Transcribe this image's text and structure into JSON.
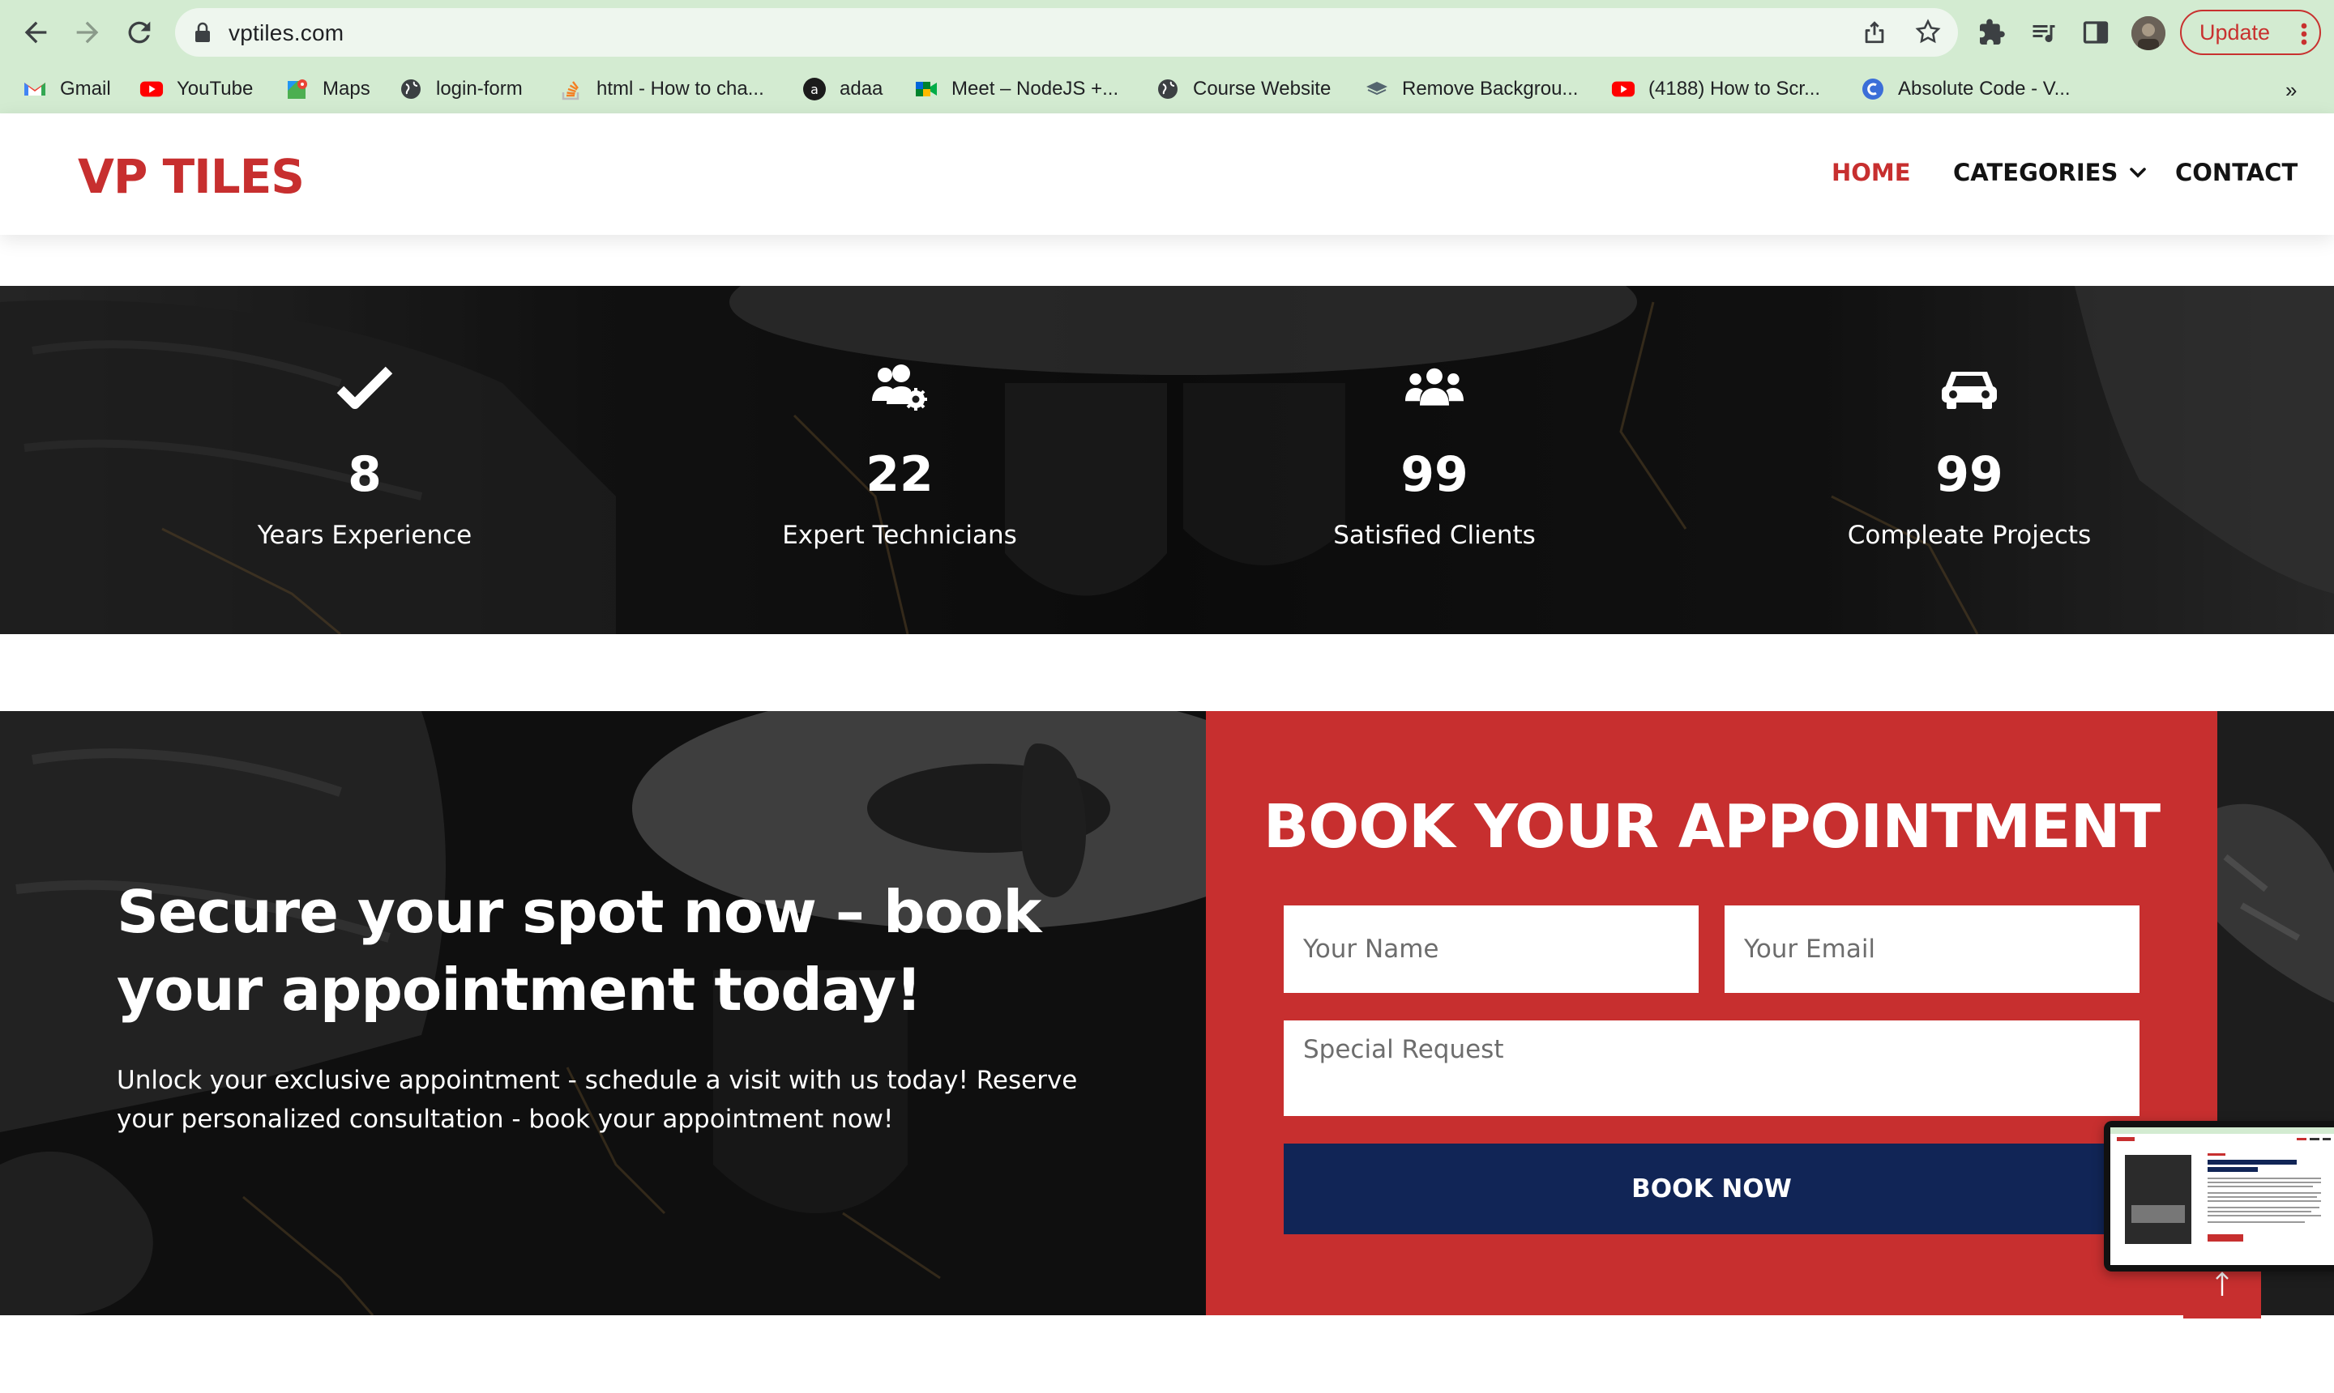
{
  "browser": {
    "url": "vptiles.com",
    "update_label": "Update",
    "bookmarks": [
      {
        "label": "Gmail",
        "icon": "gmail-icon"
      },
      {
        "label": "YouTube",
        "icon": "youtube-icon"
      },
      {
        "label": "Maps",
        "icon": "maps-icon"
      },
      {
        "label": "login-form",
        "icon": "globe-icon"
      },
      {
        "label": "html - How to cha...",
        "icon": "stackoverflow-icon"
      },
      {
        "label": "adaa",
        "icon": "adaa-icon"
      },
      {
        "label": "Meet – NodeJS +...",
        "icon": "meet-icon"
      },
      {
        "label": "Course Website",
        "icon": "globe-icon"
      },
      {
        "label": "Remove Backgrou...",
        "icon": "layers-icon"
      },
      {
        "label": "(4188) How to Scr...",
        "icon": "youtube-icon"
      },
      {
        "label": "Absolute Code - V...",
        "icon": "absolute-code-icon"
      }
    ],
    "more_label": "»"
  },
  "site": {
    "logo": "VP TILES",
    "nav": {
      "home": "HOME",
      "categories": "CATEGORIES",
      "contact": "CONTACT"
    }
  },
  "stats": [
    {
      "icon": "check-icon",
      "number": "8",
      "label": "Years Experience"
    },
    {
      "icon": "users-cog-icon",
      "number": "22",
      "label": "Expert Technicians"
    },
    {
      "icon": "users-icon",
      "number": "99",
      "label": "Satisfied Clients"
    },
    {
      "icon": "car-icon",
      "number": "99",
      "label": "Compleate Projects"
    }
  ],
  "appointment": {
    "heading": "Secure your spot now – book your appointment today!",
    "text": "Unlock your exclusive appointment - schedule a visit with us today! Reserve your personalized consultation - book your appointment now!",
    "form_title": "BOOK YOUR APPOINTMENT",
    "name_placeholder": "Your Name",
    "email_placeholder": "Your Email",
    "request_placeholder": "Special Request",
    "button": "BOOK NOW"
  },
  "colors": {
    "brand_red": "#c72f2f",
    "navy": "#112556",
    "chrome_green": "#d3ebd1"
  }
}
